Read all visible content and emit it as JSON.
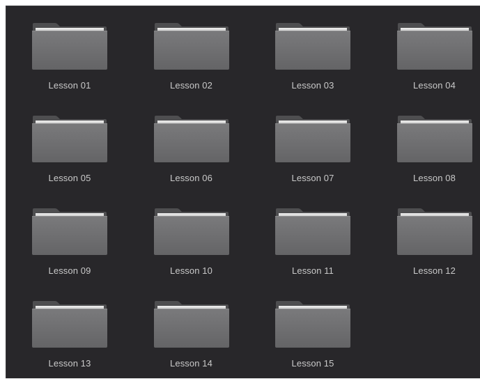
{
  "media_pool": {
    "folders": [
      {
        "label": "Lesson 01"
      },
      {
        "label": "Lesson 02"
      },
      {
        "label": "Lesson 03"
      },
      {
        "label": "Lesson 04"
      },
      {
        "label": "Lesson 05"
      },
      {
        "label": "Lesson 06"
      },
      {
        "label": "Lesson 07"
      },
      {
        "label": "Lesson 08"
      },
      {
        "label": "Lesson 09"
      },
      {
        "label": "Lesson 10"
      },
      {
        "label": "Lesson 11"
      },
      {
        "label": "Lesson 12"
      },
      {
        "label": "Lesson 13"
      },
      {
        "label": "Lesson 14"
      },
      {
        "label": "Lesson 15"
      }
    ],
    "icon": "folder-icon",
    "colors": {
      "background": "#28272a",
      "folder_body": "#6f6f71",
      "folder_back": "#4e4e50",
      "paper": "#d8d8d8",
      "label_text": "#c9c9c9"
    }
  }
}
